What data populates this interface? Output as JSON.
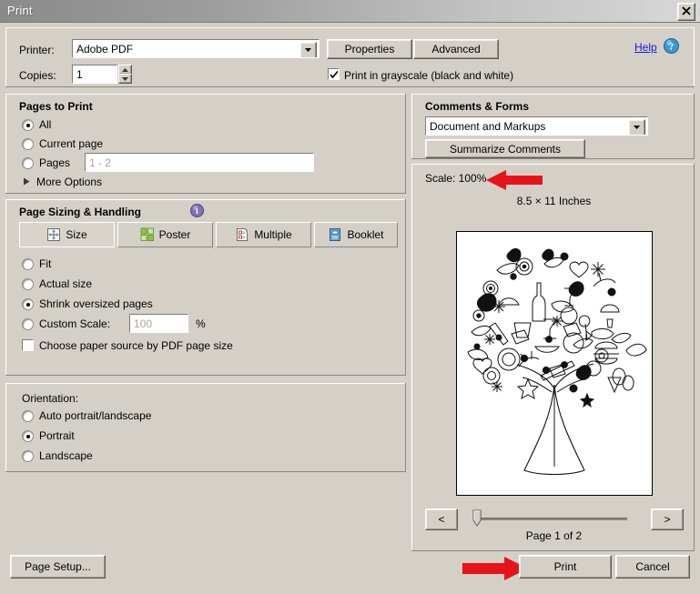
{
  "window": {
    "title": "Print",
    "close_label": "×"
  },
  "printer": {
    "printer_label": "Printer:",
    "printer_value": "Adobe PDF",
    "properties_button": "Properties",
    "advanced_button": "Advanced",
    "help_link": "Help",
    "copies_label": "Copies:",
    "copies_value": "1",
    "grayscale_label": "Print in grayscale (black and white)",
    "grayscale_checked": true
  },
  "pages_to_print": {
    "title": "Pages to Print",
    "options": [
      {
        "label": "All",
        "selected": true
      },
      {
        "label": "Current page",
        "selected": false
      },
      {
        "label": "Pages",
        "selected": false
      }
    ],
    "pages_placeholder": "1 - 2",
    "more_options": "More Options"
  },
  "page_sizing": {
    "title": "Page Sizing & Handling",
    "info_icon": "info-icon",
    "buttons": [
      {
        "label": "Size",
        "icon": "size-icon",
        "selected": true
      },
      {
        "label": "Poster",
        "icon": "poster-icon",
        "selected": false
      },
      {
        "label": "Multiple",
        "icon": "multiple-icon",
        "selected": false
      },
      {
        "label": "Booklet",
        "icon": "booklet-icon",
        "selected": false
      }
    ],
    "options": [
      {
        "label": "Fit",
        "selected": false
      },
      {
        "label": "Actual size",
        "selected": false
      },
      {
        "label": "Shrink oversized pages",
        "selected": true
      },
      {
        "label": "Custom Scale:",
        "selected": false
      }
    ],
    "custom_scale_value": "100",
    "percent_symbol": "%",
    "paper_source_label": "Choose paper source by PDF page size",
    "paper_source_checked": false
  },
  "orientation": {
    "title": "Orientation:",
    "options": [
      {
        "label": "Auto portrait/landscape",
        "selected": false
      },
      {
        "label": "Portrait",
        "selected": true
      },
      {
        "label": "Landscape",
        "selected": false
      }
    ]
  },
  "comments_forms": {
    "title": "Comments & Forms",
    "dropdown_value": "Document and Markups",
    "summarize_button": "Summarize Comments"
  },
  "preview": {
    "scale_text": "Scale: 100%",
    "paper_size_text": "8.5 × 11 Inches",
    "prev_button": "<",
    "next_button": ">",
    "page_indicator": "Page 1 of 2",
    "document_description": "Black and white illustration of a tree whose canopy is composed of many small food and nature icons"
  },
  "footer": {
    "page_setup_button": "Page Setup...",
    "print_button": "Print",
    "cancel_button": "Cancel"
  },
  "annotations": [
    {
      "name": "scale-arrow",
      "direction": "left",
      "color": "#e8131a"
    },
    {
      "name": "print-arrow",
      "direction": "right",
      "color": "#e8131a"
    }
  ],
  "colors": {
    "dialog_bg": "#d4d0c8",
    "link": "#1a1ad2",
    "annotation_red": "#e8131a",
    "title_gradient_start": "#8a8a8a",
    "title_gradient_end": "#d8d8d8"
  }
}
